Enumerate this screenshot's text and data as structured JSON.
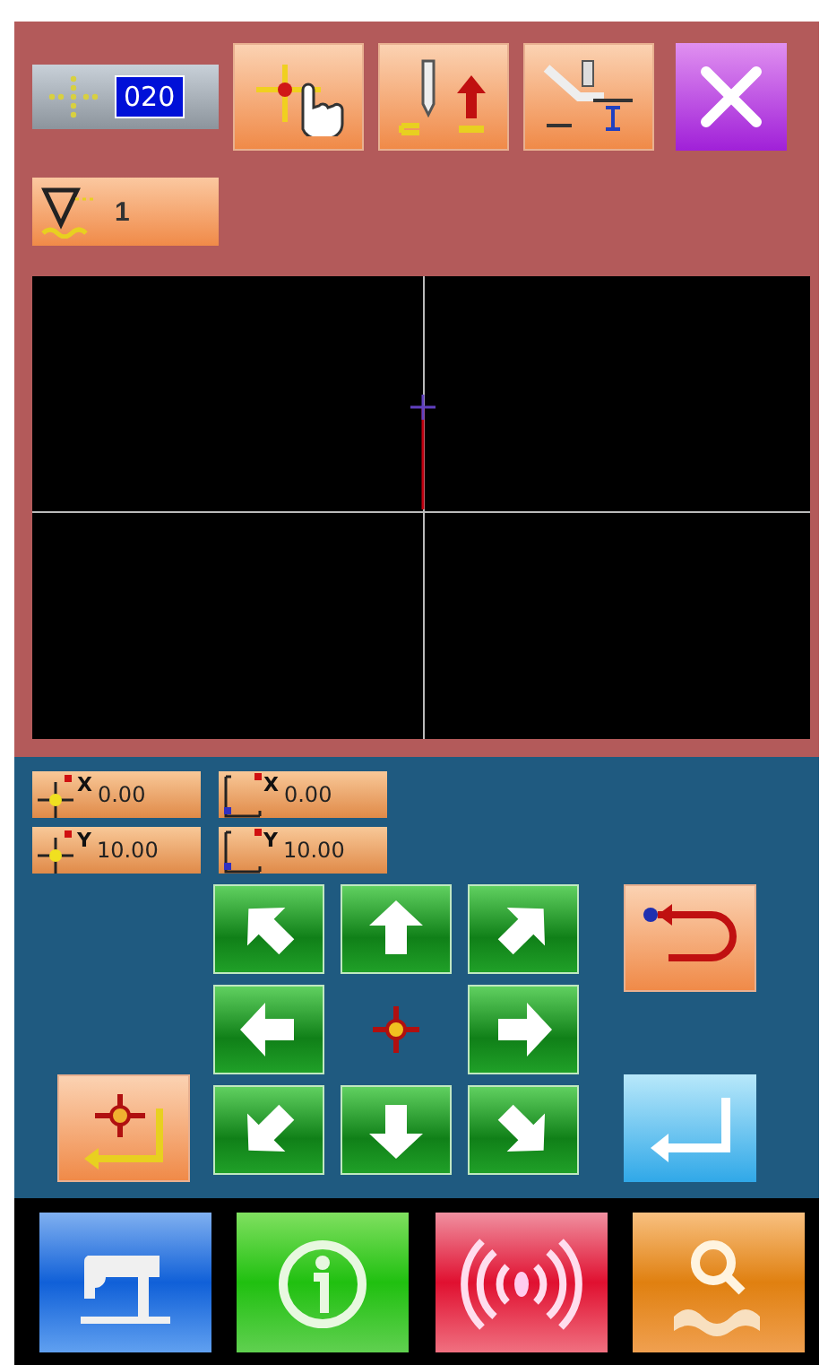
{
  "toolbar": {
    "speed_value": "020"
  },
  "stitch_button": {
    "value": "1"
  },
  "coordinates": [
    {
      "kind": "move",
      "axis": "X",
      "value": "0.00"
    },
    {
      "kind": "size",
      "axis": "X",
      "value": "0.00"
    },
    {
      "kind": "move",
      "axis": "Y",
      "value": "10.00"
    },
    {
      "kind": "size",
      "axis": "Y",
      "value": "10.00"
    }
  ]
}
